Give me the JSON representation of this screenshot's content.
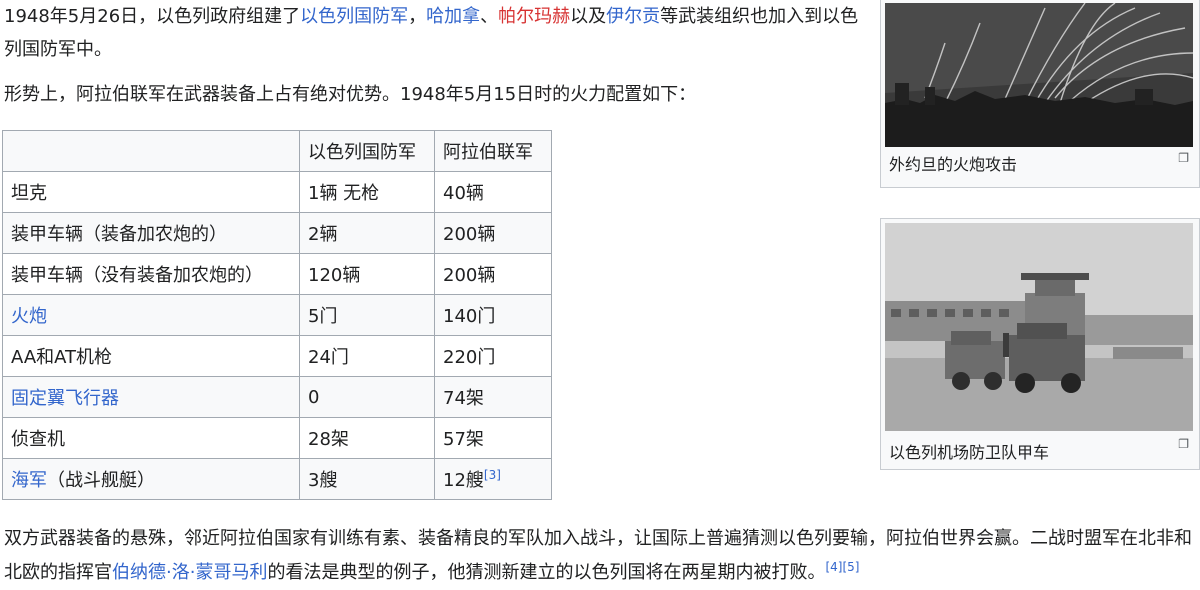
{
  "para1": {
    "t1": "1948年5月26日，以色列政府组建了",
    "l1": "以色列国防军",
    "t2": "，",
    "l2": "哈加拿",
    "t3": "、",
    "l3": "帕尔玛赫",
    "t4": "以及",
    "l4": "伊尔贡",
    "t5": "等武装组织也加入到以色列国防军中。"
  },
  "para2": "形势上，阿拉伯联军在武器装备上占有绝对优势。1948年5月15日时的火力配置如下：",
  "table": {
    "headers": [
      "",
      "以色列国防军",
      "阿拉伯联军"
    ],
    "rows": [
      {
        "label": "坦克",
        "isr": "1辆 无枪",
        "arab": "40辆"
      },
      {
        "label": "装甲车辆（装备加农炮的）",
        "isr": "2辆",
        "arab": "200辆"
      },
      {
        "label": "装甲车辆（没有装备加农炮的）",
        "isr": "120辆",
        "arab": "200辆"
      },
      {
        "label": "火炮",
        "isr": "5门",
        "arab": "140门"
      },
      {
        "label": "AA和AT机枪",
        "isr": "24门",
        "arab": "220门"
      },
      {
        "label": "固定翼飞行器",
        "isr": "0",
        "arab": "74架"
      },
      {
        "label": "侦查机",
        "isr": "28架",
        "arab": "57架"
      },
      {
        "label_link": "海军",
        "label_rest": "（战斗舰艇）",
        "isr": "3艘",
        "arab": "12艘",
        "ref": "[3]"
      }
    ]
  },
  "para3": {
    "t1": "双方武器装备的悬殊，邻近阿拉伯国家有训练有素、装备精良的军队加入战斗，让国际上普遍猜测以色列要输，阿拉伯世界会赢。二战时盟军在北非和北欧的指挥官",
    "l1": "伯纳德·洛·蒙哥马利",
    "t2": "的看法是典型的例子，他猜测新建立的以色列国将在两星期内被打败。",
    "ref1": "[4]",
    "ref2": "[5]"
  },
  "thumb1": {
    "caption": "外约旦的火炮攻击",
    "enlarge_icon": "enlarge-icon"
  },
  "thumb2": {
    "caption": "以色列机场防卫队甲车",
    "enlarge_icon": "enlarge-icon"
  }
}
